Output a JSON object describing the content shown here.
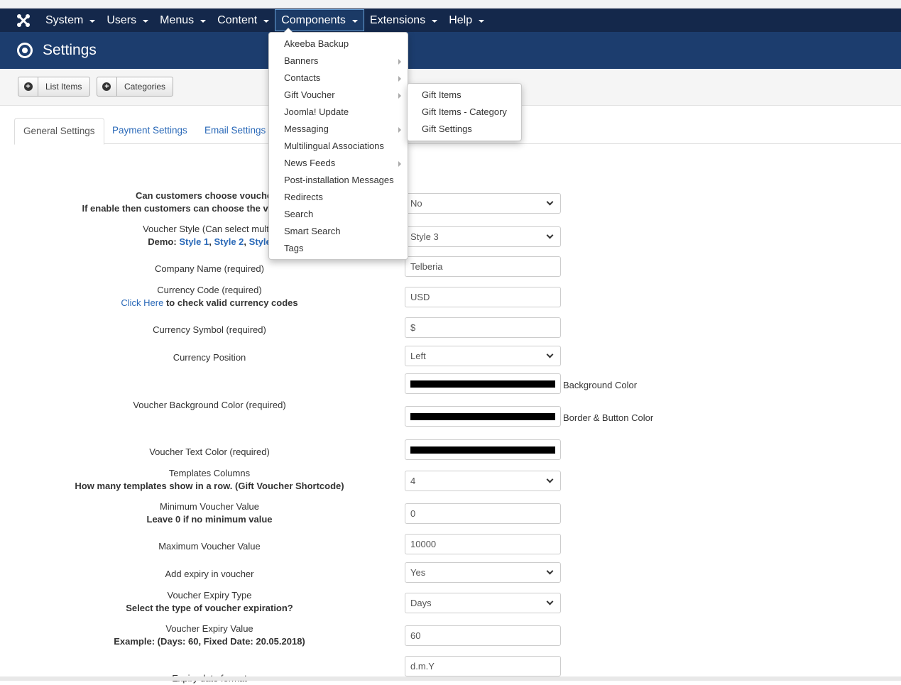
{
  "nav": {
    "items": [
      "System",
      "Users",
      "Menus",
      "Content",
      "Components",
      "Extensions",
      "Help"
    ],
    "active": "Components"
  },
  "header": {
    "title": "Settings"
  },
  "toolbar": {
    "list_items": "List Items",
    "categories": "Categories"
  },
  "tabs": [
    "General Settings",
    "Payment Settings",
    "Email Settings"
  ],
  "components_menu": [
    {
      "label": "Akeeba Backup",
      "submenu": false
    },
    {
      "label": "Banners",
      "submenu": true
    },
    {
      "label": "Contacts",
      "submenu": true
    },
    {
      "label": "Gift Voucher",
      "submenu": true
    },
    {
      "label": "Joomla! Update",
      "submenu": false
    },
    {
      "label": "Messaging",
      "submenu": true
    },
    {
      "label": "Multilingual Associations",
      "submenu": false
    },
    {
      "label": "News Feeds",
      "submenu": true
    },
    {
      "label": "Post-installation Messages",
      "submenu": false
    },
    {
      "label": "Redirects",
      "submenu": false
    },
    {
      "label": "Search",
      "submenu": false
    },
    {
      "label": "Smart Search",
      "submenu": false
    },
    {
      "label": "Tags",
      "submenu": false
    }
  ],
  "gift_voucher_submenu": [
    "Gift Items",
    "Gift Items - Category",
    "Gift Settings"
  ],
  "form": {
    "choose_style_label": "Can customers choose voucher s",
    "choose_style_hint": "If enable then customers can choose the voucher styles fr",
    "choose_style_value": "No",
    "voucher_style_label": "Voucher Style (Can select multip",
    "voucher_style_demo": "Demo:",
    "voucher_style_links": [
      "Style 1",
      "Style 2",
      "Style"
    ],
    "voucher_style_value": "Style 3",
    "company_name_label": "Company Name (required)",
    "company_name_value": "Telberia",
    "currency_code_label": "Currency Code (required)",
    "currency_code_link": "Click Here",
    "currency_code_hint": "to check valid currency codes",
    "currency_code_value": "USD",
    "currency_symbol_label": "Currency Symbol (required)",
    "currency_symbol_value": "$",
    "currency_position_label": "Currency Position",
    "currency_position_value": "Left",
    "bg_color_label": "Voucher Background Color (required)",
    "bg_color_side": "Background Color",
    "border_color_side": "Border & Button Color",
    "text_color_label": "Voucher Text Color (required)",
    "templates_columns_label": "Templates Columns",
    "templates_columns_hint": "How many templates show in a row. (Gift Voucher Shortcode)",
    "templates_columns_value": "4",
    "min_value_label": "Minimum Voucher Value",
    "min_value_hint": "Leave 0 if no minimum value",
    "min_value_value": "0",
    "max_value_label": "Maximum Voucher Value",
    "max_value_value": "10000",
    "add_expiry_label": "Add expiry in voucher",
    "add_expiry_value": "Yes",
    "expiry_type_label": "Voucher Expiry Type",
    "expiry_type_hint": "Select the type of voucher expiration?",
    "expiry_type_value": "Days",
    "expiry_value_label": "Voucher Expiry Value",
    "expiry_value_hint": "Example: (Days: 60, Fixed Date: 20.05.2018)",
    "expiry_value_value": "60",
    "date_format_label": "Expiry date format",
    "date_format_value": "d.m.Y"
  }
}
